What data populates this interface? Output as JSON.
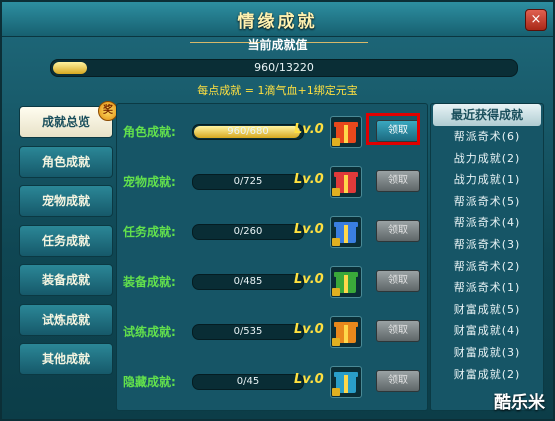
{
  "window": {
    "title": "情缘成就",
    "close_label": "×"
  },
  "summary": {
    "title": "当前成就值",
    "current": 960,
    "max": 13220,
    "value_text": "960/13220",
    "progress": 0.073
  },
  "note": "每点成就 = 1滴气血+1绑定元宝",
  "tabs": [
    {
      "label": "成就总览",
      "active": true,
      "badge": "奖"
    },
    {
      "label": "角色成就"
    },
    {
      "label": "宠物成就"
    },
    {
      "label": "任务成就"
    },
    {
      "label": "装备成就"
    },
    {
      "label": "试炼成就"
    },
    {
      "label": "其他成就"
    }
  ],
  "rows": [
    {
      "label": "角色成就:",
      "value_text": "960/680",
      "progress": 1.0,
      "lv_prefix": "Lv.",
      "level": "0",
      "gift_color": "#e8481c",
      "claim_label": "领取",
      "claimable": true
    },
    {
      "label": "宠物成就:",
      "value_text": "0/725",
      "progress": 0,
      "lv_prefix": "Lv.",
      "level": "0",
      "gift_color": "#e03a3a",
      "claim_label": "领取",
      "claimable": false
    },
    {
      "label": "任务成就:",
      "value_text": "0/260",
      "progress": 0,
      "lv_prefix": "Lv.",
      "level": "0",
      "gift_color": "#3a7ee0",
      "claim_label": "领取",
      "claimable": false
    },
    {
      "label": "装备成就:",
      "value_text": "0/485",
      "progress": 0,
      "lv_prefix": "Lv.",
      "level": "0",
      "gift_color": "#3aa83a",
      "claim_label": "领取",
      "claimable": false
    },
    {
      "label": "试练成就:",
      "value_text": "0/535",
      "progress": 0,
      "lv_prefix": "Lv.",
      "level": "0",
      "gift_color": "#e8881c",
      "claim_label": "领取",
      "claimable": false
    },
    {
      "label": "隐藏成就:",
      "value_text": "0/45",
      "progress": 0,
      "lv_prefix": "Lv.",
      "level": "0",
      "gift_color": "#2a9ec8",
      "claim_label": "领取",
      "claimable": false
    }
  ],
  "recent": {
    "title": "最近获得成就",
    "items": [
      "帮派奇术(6)",
      "战力成就(2)",
      "战力成就(1)",
      "帮派奇术(5)",
      "帮派奇术(4)",
      "帮派奇术(3)",
      "帮派奇术(2)",
      "帮派奇术(1)",
      "财富成就(5)",
      "财富成就(4)",
      "财富成就(3)",
      "财富成就(2)"
    ]
  },
  "watermark": "酷乐米",
  "colors": {
    "accent": "#ffe040",
    "label_green": "#62e04c",
    "highlight": "#e00000"
  }
}
